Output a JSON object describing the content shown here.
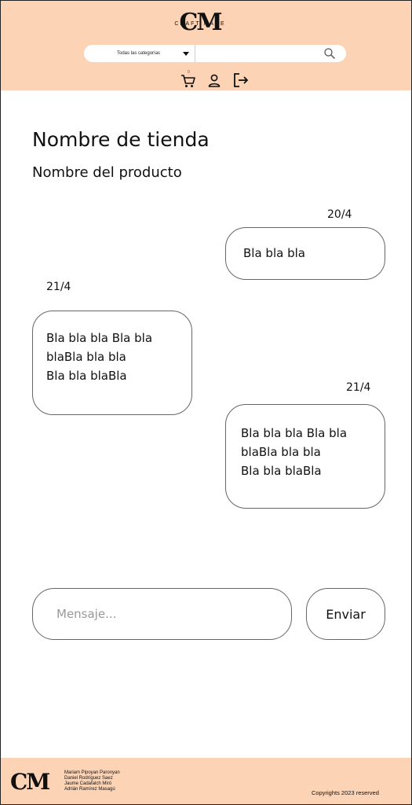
{
  "header": {
    "logo_mark": "CM",
    "logo_sub": "CRAFT MADE",
    "category_select": "Todas las categorías",
    "search_placeholder": "",
    "cart_badge": "0",
    "background": "#fdd3b5"
  },
  "main": {
    "store_title": "Nombre de tienda",
    "product_title": "Nombre del producto",
    "messages": [
      {
        "date": "20/4",
        "side": "right",
        "lines": [
          "Bla bla bla"
        ]
      },
      {
        "date": "21/4",
        "side": "left",
        "lines": [
          "Bla bla bla Bla bla",
          "blaBla bla bla",
          "Bla bla blaBla"
        ]
      },
      {
        "date": "21/4",
        "side": "right",
        "lines": [
          "Bla bla bla Bla bla",
          "blaBla bla bla",
          "Bla bla blaBla"
        ]
      }
    ],
    "message_placeholder": "Mensaje...",
    "send_label": "Enviar"
  },
  "footer": {
    "logo_mark": "CM",
    "authors": [
      "Mariam Pipoyan Paronyan",
      "Daniel Rodríguez Saez",
      "Jaume Cadafalch Miró",
      "Adrián Ramírez Masagú"
    ],
    "copyright": "Copyrights 2023 reserved"
  },
  "icons": [
    "search-icon",
    "cart-icon",
    "user-icon",
    "logout-icon"
  ]
}
